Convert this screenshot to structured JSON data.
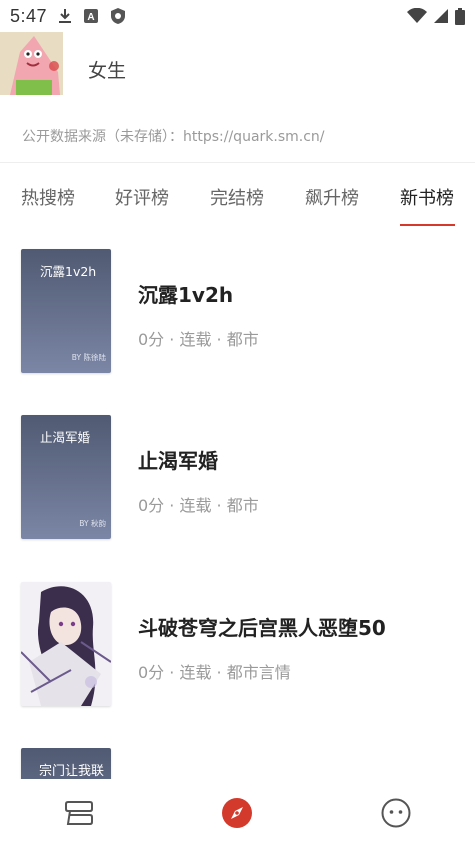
{
  "status": {
    "time": "5:47",
    "icons": [
      "download-icon",
      "a-box-icon",
      "shield-icon",
      "wifi-icon",
      "signal-icon",
      "battery-icon"
    ]
  },
  "header": {
    "title": "女生"
  },
  "source_text": "公开数据来源（未存储）：https://quark.sm.cn/",
  "tabs": [
    {
      "label": "热搜榜"
    },
    {
      "label": "好评榜"
    },
    {
      "label": "完结榜"
    },
    {
      "label": "飙升榜"
    },
    {
      "label": "新书榜",
      "active": true
    }
  ],
  "books": [
    {
      "title": "沉露1v2h",
      "meta": "0分 · 连载 · 都市",
      "cover_title": "沉露1v2h",
      "cover_author": "BY 陈徐陆"
    },
    {
      "title": "止渴军婚",
      "meta": "0分 · 连载 · 都市",
      "cover_title": "止渴军婚",
      "cover_author": "BY 秋韵"
    },
    {
      "title": "斗破苍穹之后宫黑人恶堕50",
      "meta": "0分 · 连载 · 都市言情",
      "cover_title": "",
      "cover_author": ""
    },
    {
      "title": "",
      "meta": "",
      "cover_title": "宗门让我联",
      "cover_author": ""
    }
  ],
  "bottom_nav": [
    "bookshelf-icon",
    "explore-icon",
    "profile-icon"
  ],
  "colors": {
    "accent": "#d43a2b",
    "text": "#222222",
    "muted": "#9a9a9a"
  }
}
